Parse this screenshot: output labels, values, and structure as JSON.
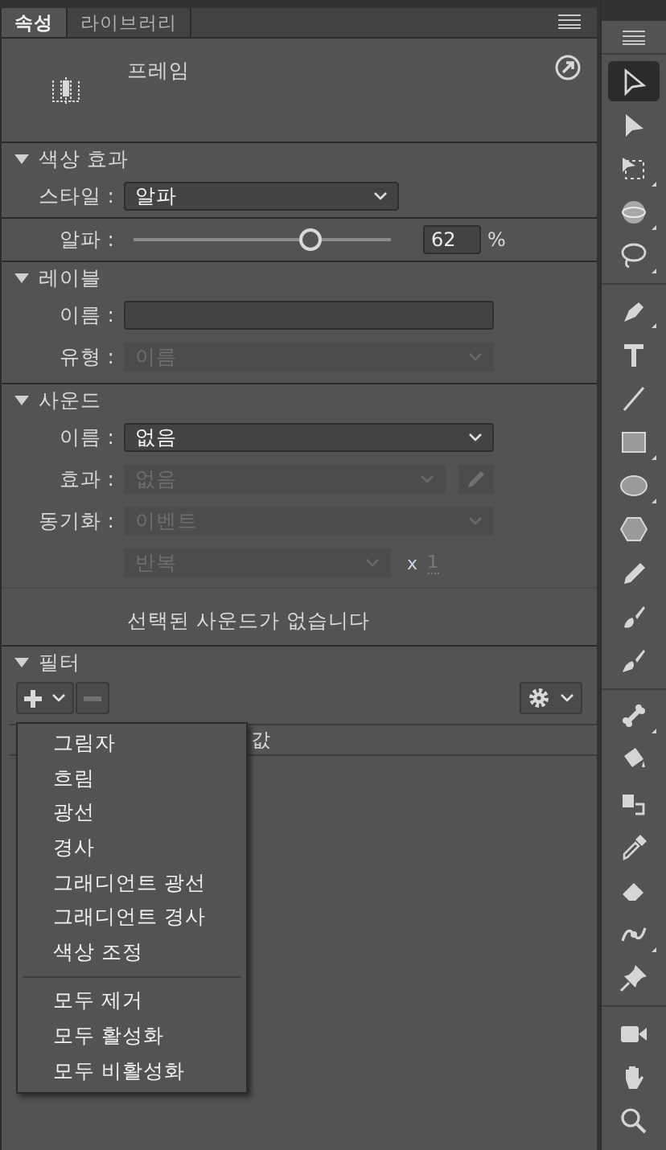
{
  "tabs": [
    {
      "label": "속성",
      "selected": true
    },
    {
      "label": "라이브러리",
      "selected": false
    }
  ],
  "frame": {
    "label": "프레임"
  },
  "color_effect": {
    "title": "색상 효과",
    "expanded": true,
    "style_label": "스타일 :",
    "style_value": "알파",
    "alpha_label": "알파 :",
    "alpha": {
      "level": 0.69,
      "reading": "62",
      "unit": "%"
    }
  },
  "label_section": {
    "title": "레이블",
    "expanded": true,
    "name_label": "이름 :",
    "type_label": "유형 :",
    "type_value": "이름",
    "type_disabled": true
  },
  "sound": {
    "title": "사운드",
    "expanded": true,
    "rows": [
      {
        "label": "이름 :",
        "value": "없음",
        "disabled": false,
        "kind": "dropdown"
      },
      {
        "label": "효과 :",
        "value": "없음",
        "disabled": true,
        "kind": "effect"
      },
      {
        "label": "동기화 :",
        "value": "이벤트",
        "disabled": true,
        "kind": "dropdown"
      },
      {
        "label": "",
        "value": "반복",
        "disabled": true,
        "kind": "repeat",
        "times_label": "x",
        "times": "1"
      }
    ],
    "message": "선택된 사운드가 없습니다"
  },
  "filter": {
    "title": "필터",
    "expanded": true,
    "columns": [
      {
        "label": "값"
      }
    ],
    "menu": [
      [
        {
          "label": "그림자"
        },
        {
          "label": "흐림"
        },
        {
          "label": "광선"
        },
        {
          "label": "경사"
        },
        {
          "label": "그래디언트 광선"
        },
        {
          "label": "그래디언트 경사"
        },
        {
          "label": "색상 조정"
        }
      ],
      [
        {
          "label": "모두 제거"
        },
        {
          "label": "모두 활성화"
        },
        {
          "label": "모두 비활성화"
        }
      ]
    ]
  },
  "toolbar": [
    [
      {
        "kind": "select",
        "selected": true
      },
      {
        "kind": "subselect",
        "selected": false
      },
      {
        "kind": "transform",
        "selected": false
      },
      {
        "kind": "rotate3d",
        "selected": false
      },
      {
        "kind": "lasso",
        "selected": false
      }
    ],
    [
      {
        "kind": "pen",
        "selected": false
      },
      {
        "kind": "text",
        "selected": false
      },
      {
        "kind": "line",
        "selected": false
      },
      {
        "kind": "rect",
        "selected": false
      },
      {
        "kind": "oval",
        "selected": false
      },
      {
        "kind": "polygon",
        "selected": false
      },
      {
        "kind": "pencil",
        "selected": false
      },
      {
        "kind": "fluidbrush",
        "selected": false
      },
      {
        "kind": "brush",
        "selected": false
      }
    ],
    [
      {
        "kind": "bone",
        "selected": false
      },
      {
        "kind": "bucket",
        "selected": false
      },
      {
        "kind": "inkbottle",
        "selected": false
      },
      {
        "kind": "eyedropper",
        "selected": false
      },
      {
        "kind": "eraser",
        "selected": false
      },
      {
        "kind": "width",
        "selected": false
      },
      {
        "kind": "pin",
        "selected": false
      }
    ],
    [
      {
        "kind": "camera",
        "selected": false
      },
      {
        "kind": "hand",
        "selected": false
      },
      {
        "kind": "zoom",
        "selected": false
      }
    ]
  ]
}
